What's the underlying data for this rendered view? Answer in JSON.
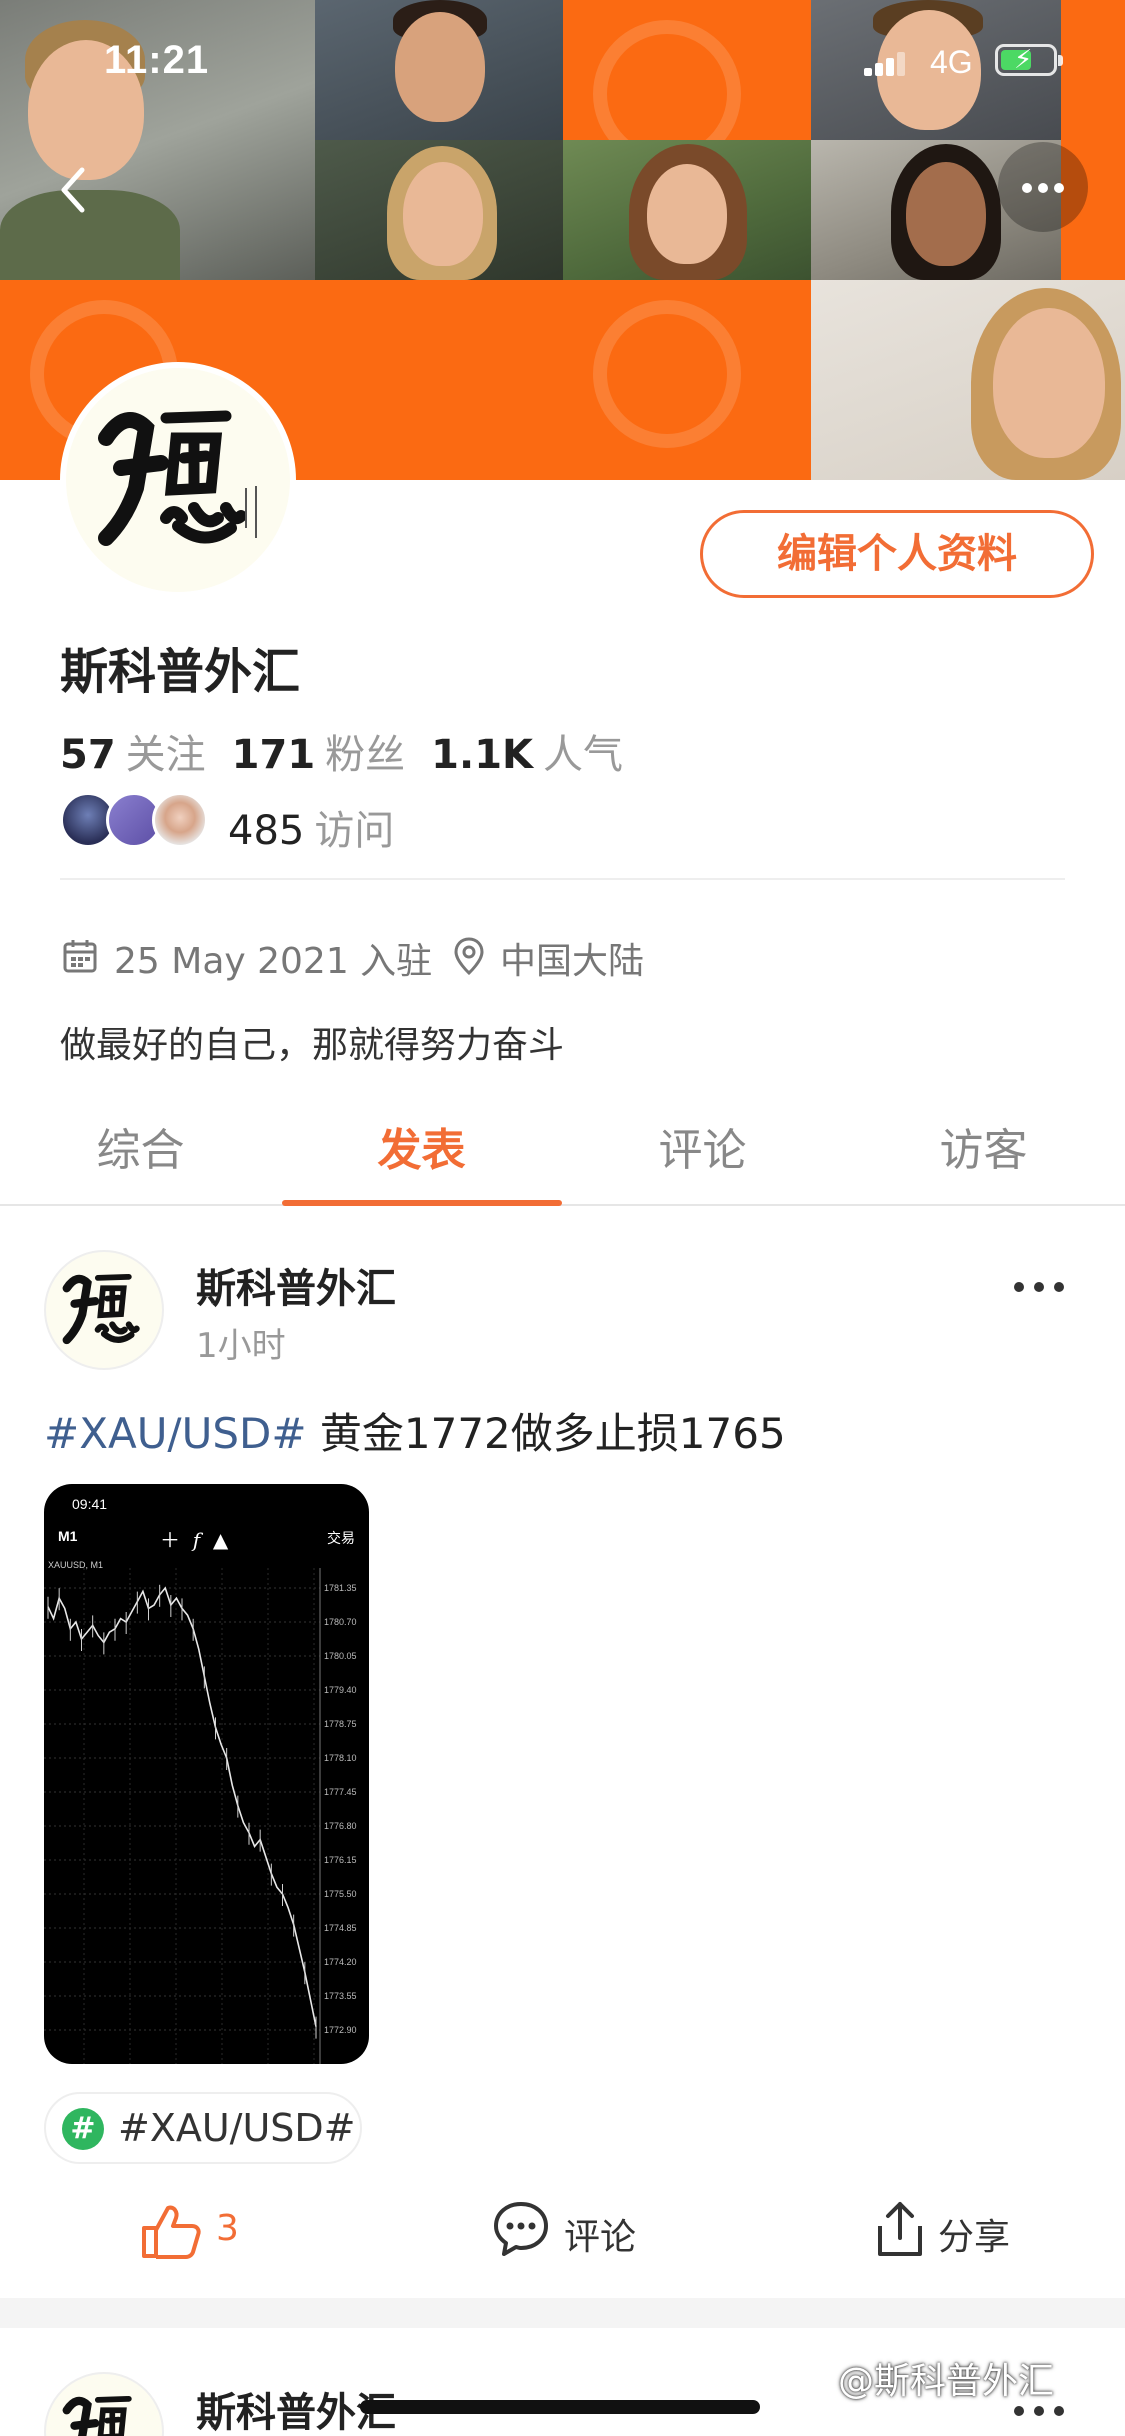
{
  "status_bar": {
    "time": "11:21",
    "network": "4G"
  },
  "profile": {
    "name": "斯科普外汇",
    "edit_label": "编辑个人资料",
    "following_count": "57",
    "following_label": "关注",
    "followers_count": "171",
    "followers_label": "粉丝",
    "popularity_count": "1.1K",
    "popularity_label": "人气",
    "visits_count": "485",
    "visits_label": "访问",
    "joined": "25 May 2021 入驻",
    "location": "中国大陆",
    "bio": "做最好的自己，那就得努力奋斗"
  },
  "tabs": [
    {
      "label": "综合"
    },
    {
      "label": "发表"
    },
    {
      "label": "评论"
    },
    {
      "label": "访客"
    }
  ],
  "active_tab": "发表",
  "post": {
    "author": "斯科普外汇",
    "time": "1小时",
    "hashtag": "#XAU/USD#",
    "text": "黄金1772做多止损1765",
    "topic_chip": "#XAU/USD#",
    "likes": "3",
    "comment_label": "评论",
    "share_label": "分享",
    "screenshot": {
      "time": "09:41",
      "timeframe": "M1",
      "trade_label": "交易",
      "symbol": "XAUUSD, M1",
      "price_ticks": [
        "1781.35",
        "1780.70",
        "1780.05",
        "1779.40",
        "1778.75",
        "1778.10",
        "1777.45",
        "1776.80",
        "1776.15",
        "1775.50",
        "1774.85",
        "1774.20",
        "1773.55",
        "1772.90"
      ]
    }
  },
  "post2": {
    "author": "斯科普外汇"
  },
  "watermark": "@斯科普外汇",
  "colors": {
    "accent": "#f26d35",
    "cover_orange": "#fb6a12",
    "hashtag_blue": "#3f5f8f",
    "topic_green": "#2fb65f"
  },
  "icons": [
    "back-icon",
    "more-icon",
    "calendar-icon",
    "location-icon",
    "like-icon",
    "comment-icon",
    "share-icon",
    "hashtag-icon"
  ]
}
